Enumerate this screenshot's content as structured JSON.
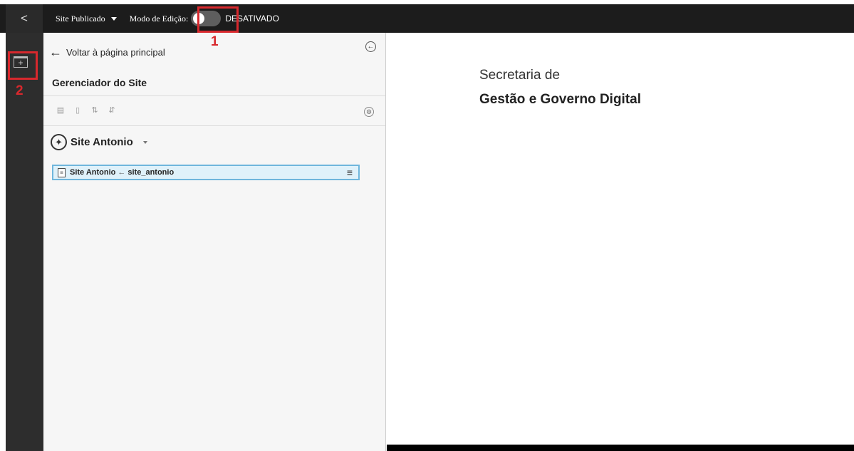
{
  "topbar": {
    "back_glyph": "<",
    "site_selector": "Site Publicado",
    "edit_mode_label": "Modo de Edição:",
    "edit_mode_state": "DESATIVADO"
  },
  "annotations": {
    "mark_1": "1",
    "mark_2": "2",
    "color": "#d8282d"
  },
  "rail": {
    "add_panel_icon": "panel-plus-icon"
  },
  "panel": {
    "back_link": "Voltar à página principal",
    "title": "Gerenciador do Site",
    "tools": [
      "copy-icon",
      "page-icon",
      "move-up-icon",
      "move-down-icon"
    ],
    "site_name": "Site Antonio",
    "tree_item": {
      "label": "Site Antonio",
      "arrow": "←",
      "slug": "site_antonio"
    }
  },
  "content": {
    "subtitle": "Secretaria de",
    "title": "Gestão e Governo Digital"
  }
}
